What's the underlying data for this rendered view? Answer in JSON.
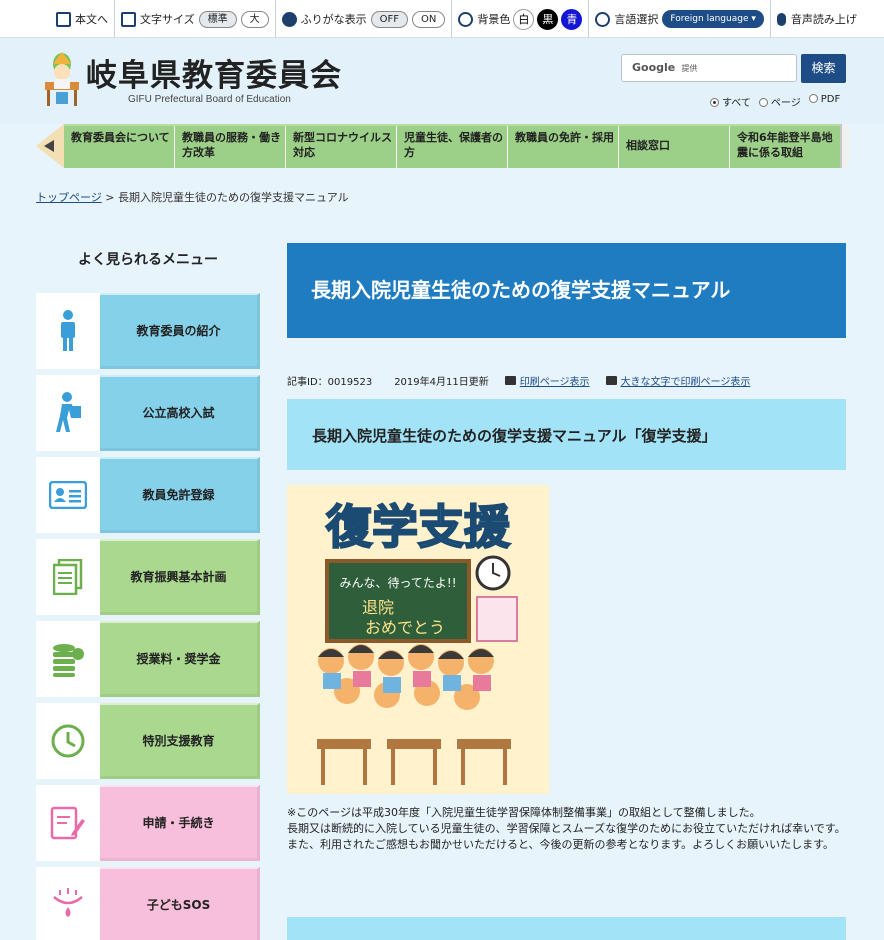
{
  "util_bar": {
    "skip_label": "本文へ",
    "font_size_label": "文字サイズ",
    "font_standard": "標準",
    "font_large": "大",
    "furigana_label": "ふりがな表示",
    "furigana_off": "OFF",
    "furigana_on": "ON",
    "bg_color_label": "背景色",
    "bg_white": "白",
    "bg_black": "黒",
    "bg_blue": "青",
    "lang_label": "言語選択",
    "lang_button": "Foreign language",
    "voice_label": "音声読み上げ"
  },
  "header": {
    "title": "岐阜県教育委員会",
    "subtitle": "GIFU Prefectural Board of Education",
    "search_google": "Google",
    "search_provided": "提供",
    "search_button": "検索",
    "scope_all": "すべて",
    "scope_page": "ページ",
    "scope_pdf": "PDF"
  },
  "nav": {
    "items": [
      {
        "label": "教育委員会について"
      },
      {
        "label": "教職員の服務・働き方改革"
      },
      {
        "label": "新型コロナウイルス対応"
      },
      {
        "label": "児童生徒、保護者の方"
      },
      {
        "label": "教職員の免許・採用"
      },
      {
        "label": "相談窓口"
      },
      {
        "label": "令和6年能登半島地震に係る取組"
      }
    ]
  },
  "breadcrumb": {
    "home": "トップページ",
    "sep": ">",
    "current": "長期入院児童生徒のための復学支援マニュアル"
  },
  "sidebar": {
    "title": "よく見られるメニュー",
    "items": [
      {
        "label": "教育委員の紹介",
        "icon": "person-icon"
      },
      {
        "label": "公立高校入試",
        "icon": "student-walking-icon"
      },
      {
        "label": "教員免許登録",
        "icon": "id-card-icon"
      },
      {
        "label": "教育振興基本計画",
        "icon": "document-icon"
      },
      {
        "label": "授業料・奨学金",
        "icon": "coins-icon"
      },
      {
        "label": "特別支援教育",
        "icon": "clock-icon"
      },
      {
        "label": "申請・手続き",
        "icon": "form-pen-icon"
      },
      {
        "label": "子どもSOS",
        "icon": "crying-eye-icon"
      }
    ]
  },
  "main": {
    "title": "長期入院児童生徒のための復学支援マニュアル",
    "article_id": "記事ID：0019523",
    "updated": "2019年4月11日更新",
    "print_link": "印刷ページ表示",
    "print_large_link": "大きな文字で印刷ページ表示",
    "subheading": "長期入院児童生徒のための復学支援マニュアル「復学支援」",
    "cover_title": "復学支援",
    "cover_board_line1": "みんな、待ってたよ!!",
    "cover_board_line2": "退院",
    "cover_board_line3": "おめでとう",
    "desc_line1": "※このページは平成30年度「入院児童生徒学習保障体制整備事業」の取組として整備しました。",
    "desc_line2": "長期又は断続的に入院している児童生徒の、学習保障とスムーズな復学のためにお役立ていただければ幸いです。",
    "desc_line3": "また、利用されたご感想もお聞かせいただけると、今後の更新の参考となります。よろしくお願いいたします。"
  },
  "colors": {
    "brand_blue": "#1f7cc0",
    "nav_green": "#9ccf87",
    "side_blue": "#85d1ea",
    "side_green": "#a9d88e",
    "side_pink": "#f8bfdc",
    "sub_blue": "#a3e3f7"
  }
}
